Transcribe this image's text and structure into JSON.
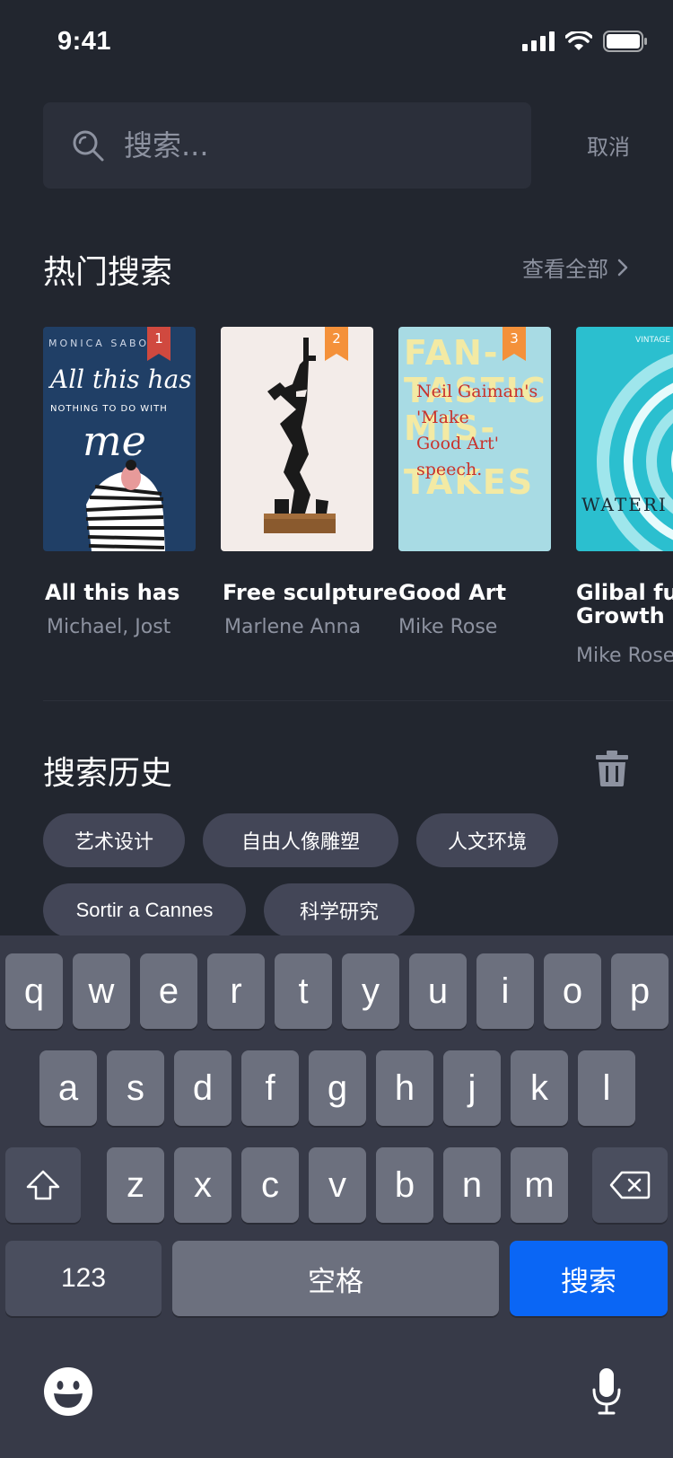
{
  "status_bar": {
    "time": "9:41"
  },
  "search": {
    "placeholder": "搜索...",
    "cancel_label": "取消"
  },
  "hot": {
    "title": "热门搜索",
    "view_all_label": "查看全部",
    "books": [
      {
        "rank": "1",
        "title": "All this has",
        "author": "Michael, Jost",
        "cover": {
          "bg": "#203f66",
          "top_text": "MONICA SABOLO",
          "text": "All this has",
          "sub": "NOTHING TO DO WITH",
          "big": "me",
          "badge_color": "#d0493f"
        }
      },
      {
        "rank": "2",
        "title": "Free sculpture",
        "author": "Marlene Anna",
        "cover": {
          "bg": "#f3ece9",
          "badge_color": "#f4913a"
        }
      },
      {
        "rank": "3",
        "title": "Good Art",
        "author": "Mike Rose",
        "cover": {
          "bg": "#a8dbe4",
          "line1": "FAN-",
          "line2": "TASTIC",
          "line3": "MIS-",
          "line4": "TAKES",
          "quote1": "Neil Gaiman's",
          "quote2": "'Make",
          "quote3": "Good Art'",
          "quote4": "speech.",
          "badge_color": "#f4913a"
        }
      },
      {
        "rank": "",
        "title": "Glibal fu",
        "title2": "Growth",
        "author": "Mike Rose",
        "cover": {
          "bg": "#2bbfcf",
          "top_text": "VINTAGE",
          "text": "WATERI"
        }
      }
    ]
  },
  "history": {
    "title": "搜索历史",
    "chips": [
      "艺术设计",
      "自由人像雕塑",
      "人文环境",
      "Sortir a Cannes",
      "科学研究"
    ]
  },
  "keyboard": {
    "row1": [
      "q",
      "w",
      "e",
      "r",
      "t",
      "y",
      "u",
      "i",
      "o",
      "p"
    ],
    "row2": [
      "a",
      "s",
      "d",
      "f",
      "g",
      "h",
      "j",
      "k",
      "l"
    ],
    "row3": [
      "z",
      "x",
      "c",
      "v",
      "b",
      "n",
      "m"
    ],
    "num_label": "123",
    "space_label": "空格",
    "search_label": "搜索"
  },
  "icons": [
    "signal-icon",
    "wifi-icon",
    "battery-icon",
    "search-icon",
    "chevron-right-icon",
    "trash-icon",
    "shift-icon",
    "backspace-icon",
    "emoji-icon",
    "microphone-icon"
  ],
  "colors": {
    "accent": "#0a66f5",
    "background": "#22262f",
    "keyboard": "#373a48"
  }
}
